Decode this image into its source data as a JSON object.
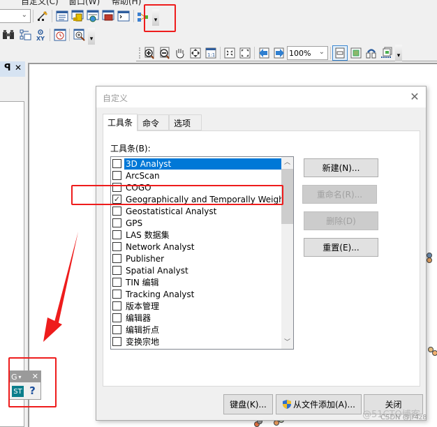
{
  "menubar": {
    "items": [
      "自定义(C)",
      "窗口(W)",
      "帮助(H)"
    ]
  },
  "toolbar1": {
    "combo_value": "",
    "buttons": [
      "editor-icon",
      "table-of-contents-icon",
      "catalog-icon",
      "search-window-icon",
      "arctoolbox-icon",
      "python-icon",
      "gtwr-toolbar-icon"
    ],
    "overflow": "▾"
  },
  "toolbar2": {
    "buttons": [
      "find-icon",
      "model-builder-icon",
      "go-to-xy-icon",
      "time-slider-icon",
      "magnifier-icon"
    ],
    "overflow": "▾"
  },
  "layout_toolbar": {
    "buttons": [
      "zoom-in-icon",
      "zoom-out-icon",
      "pan-icon",
      "zoom-whole-page-icon",
      "zoom-100-icon",
      "fixed-zoom-in-icon",
      "fixed-zoom-out-icon",
      "back-icon",
      "forward-icon"
    ],
    "zoom_value": "100%",
    "buttons_after": [
      "toggle-draft-mode-icon",
      "focus-data-frame-icon",
      "change-layout-icon",
      "data-driven-pages-icon"
    ],
    "overflow": "▾"
  },
  "left_panel": {
    "pin": "ᵖ",
    "close": "✕"
  },
  "dialog": {
    "title": "自定义",
    "close": "✕",
    "tabs": [
      {
        "label": "工具条",
        "active": true
      },
      {
        "label": "命令",
        "active": false
      },
      {
        "label": "选项",
        "active": false
      }
    ],
    "list_label": "工具条(B):",
    "toolbars": [
      {
        "label": "3D Analyst",
        "checked": false,
        "selected": true
      },
      {
        "label": "ArcScan",
        "checked": false,
        "selected": false
      },
      {
        "label": "COGO",
        "checked": false,
        "selected": false
      },
      {
        "label": "Geographically and Temporally Weighted Regression",
        "checked": true,
        "selected": false
      },
      {
        "label": "Geostatistical Analyst",
        "checked": false,
        "selected": false
      },
      {
        "label": "GPS",
        "checked": false,
        "selected": false
      },
      {
        "label": "LAS 数据集",
        "checked": false,
        "selected": false
      },
      {
        "label": "Network Analyst",
        "checked": false,
        "selected": false
      },
      {
        "label": "Publisher",
        "checked": false,
        "selected": false
      },
      {
        "label": "Spatial Analyst",
        "checked": false,
        "selected": false
      },
      {
        "label": "TIN 编辑",
        "checked": false,
        "selected": false
      },
      {
        "label": "Tracking Analyst",
        "checked": false,
        "selected": false
      },
      {
        "label": "版本管理",
        "checked": false,
        "selected": false
      },
      {
        "label": "编辑器",
        "checked": false,
        "selected": false
      },
      {
        "label": "编辑折点",
        "checked": false,
        "selected": false
      },
      {
        "label": "变换宗地",
        "checked": false,
        "selected": false
      }
    ],
    "scroll_position": 0.0,
    "side_buttons": [
      {
        "label": "新建(N)...",
        "enabled": true
      },
      {
        "label": "重命名(R)...",
        "enabled": false
      },
      {
        "label": "删除(D)",
        "enabled": false
      },
      {
        "label": "重置(E)...",
        "enabled": true
      }
    ],
    "footer_buttons": {
      "keyboard": "键盘(K)...",
      "add_from_file": "从文件添加(A)...",
      "close": "关闭"
    }
  },
  "floating_toolbar": {
    "title": "G",
    "dropdown": "▾",
    "close": "✕",
    "st_label": "ST",
    "help_label": "?"
  },
  "watermark": {
    "line1": "@51CTO博客",
    "line2": "CSDN @jr4z8"
  },
  "annotation_color": "#ee1c1c"
}
